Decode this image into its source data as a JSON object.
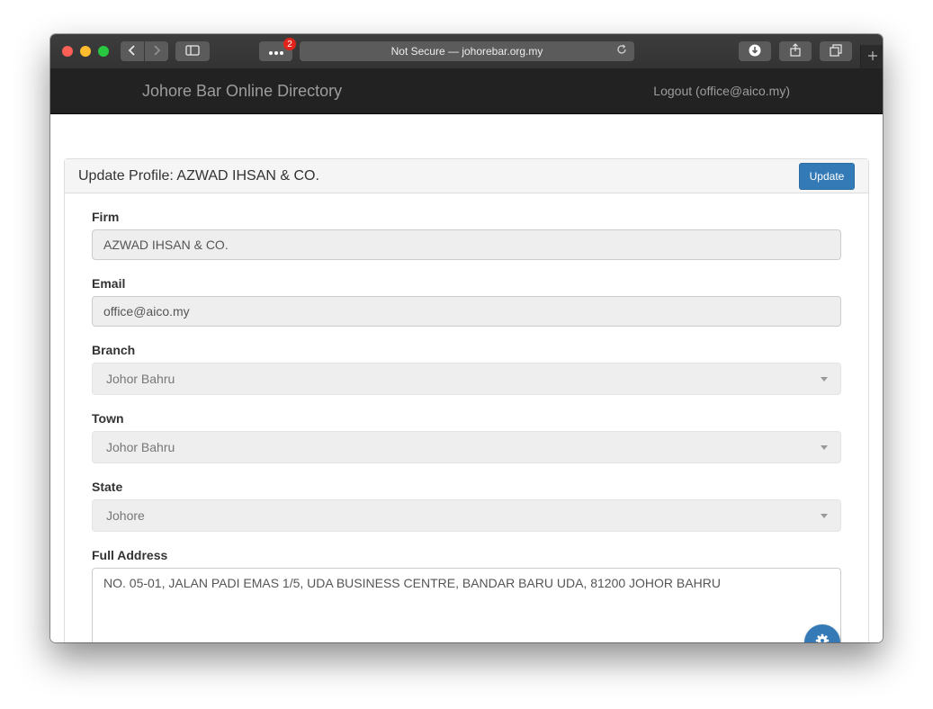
{
  "browser": {
    "address_text": "Not Secure — johorebar.org.my",
    "extensions_badge": "2"
  },
  "navbar": {
    "brand": "Johore Bar Online Directory",
    "logout_label": "Logout (office@aico.my)"
  },
  "panel": {
    "title": "Update Profile: AZWAD IHSAN & CO.",
    "update_button": "Update"
  },
  "form": {
    "firm_label": "Firm",
    "firm_value": "AZWAD IHSAN & CO.",
    "email_label": "Email",
    "email_value": "office@aico.my",
    "branch_label": "Branch",
    "branch_value": "Johor Bahru",
    "town_label": "Town",
    "town_value": "Johor Bahru",
    "state_label": "State",
    "state_value": "Johore",
    "address_label": "Full Address",
    "address_value": "NO. 05-01, JALAN PADI EMAS 1/5, UDA BUSINESS CENTRE, BANDAR BARU UDA, 81200 JOHOR BAHRU"
  },
  "colors": {
    "primary": "#337ab7",
    "navbar_bg": "#222222",
    "field_disabled_bg": "#eeeeee"
  },
  "icons": {
    "back": "chevron-left-icon",
    "forward": "chevron-right-icon",
    "sidebar": "sidebar-icon",
    "extensions": "ellipsis-icon",
    "reload": "reload-icon",
    "download": "download-icon",
    "share": "share-icon",
    "tabs": "tabs-icon",
    "new_tab": "plus-icon",
    "fab": "gear-icon"
  }
}
